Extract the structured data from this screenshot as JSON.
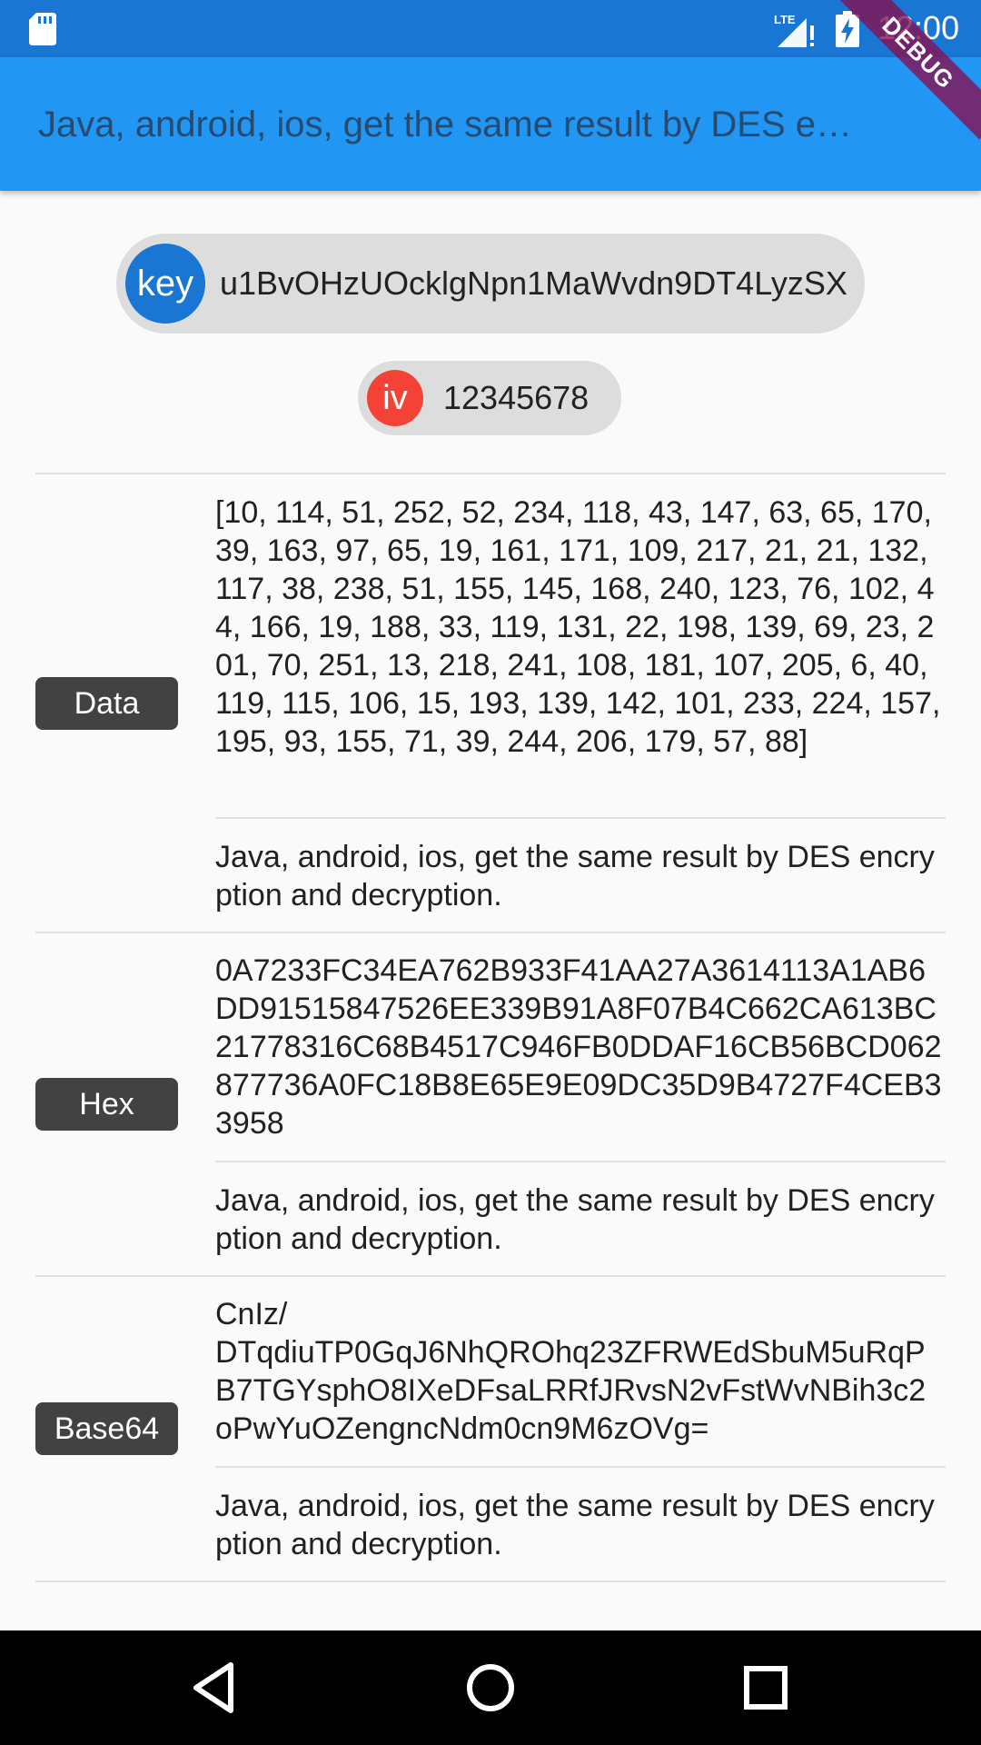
{
  "status_bar": {
    "time": "12:00",
    "network_label": "LTE",
    "icons": [
      "sd-card-icon",
      "signal-icon",
      "battery-charging-icon"
    ],
    "color": "#1976d2"
  },
  "app_bar": {
    "title": "Java, android, ios, get the same result by DES encryption and decryption.",
    "color": "#2196f3"
  },
  "debug_banner": {
    "label": "DEBUG"
  },
  "chips": {
    "key": {
      "avatar": "key",
      "value": "u1BvOHzUOcklgNpn1MaWvdn9DT4LyzSX",
      "avatar_color": "#1976d2"
    },
    "iv": {
      "avatar": "iv",
      "value": "12345678",
      "avatar_color": "#f44336"
    }
  },
  "sections": {
    "data": {
      "label": "Data",
      "encrypted": "[10, 114, 51, 252, 52, 234, 118, 43, 147, 63, 65, 170, 39, 163, 97, 65, 19, 161, 171, 109, 217, 21, 21, 132, 117, 38, 238, 51, 155, 145, 168, 240, 123, 76, 102, 44, 166, 19, 188, 33, 119, 131, 22, 198, 139, 69, 23, 201, 70, 251, 13, 218, 241, 108, 181, 107, 205, 6, 40, 119, 115, 106, 15, 193, 139, 142, 101, 233, 224, 157, 195, 93, 155, 71, 39, 244, 206, 179, 57, 88]",
      "decrypted": "Java, android, ios, get the same result by DES encryption and decryption."
    },
    "hex": {
      "label": "Hex",
      "encrypted": "0A7233FC34EA762B933F41AA27A3614113A1AB6DD91515847526EE339B91A8F07B4C662CA613BC21778316C68B4517C946FB0DDAF16CB56BCD062877736A0FC18B8E65E9E09DC35D9B4727F4CEB33958",
      "decrypted": "Java, android, ios, get the same result by DES encryption and decryption."
    },
    "base64": {
      "label": "Base64",
      "encrypted": "CnIz/\nDTqdiuTP0GqJ6NhQROhq23ZFRWEdSbuM5uRqPB7TGYsphO8IXeDFsaLRRfJRvsN2vFstWvNBih3c2oPwYuOZengncNdm0cn9M6zOVg=",
      "decrypted": "Java, android, ios, get the same result by DES encryption and decryption."
    }
  },
  "nav_bar": {
    "buttons": [
      "back-icon",
      "home-icon",
      "recents-icon"
    ]
  }
}
